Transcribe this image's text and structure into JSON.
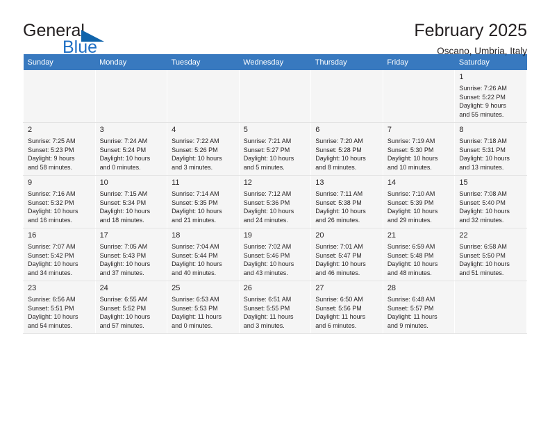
{
  "logo": {
    "word_one": "General",
    "word_two": "Blue",
    "triangle_icon": "blue-triangle-icon",
    "brand_blue": "#1f6fc4",
    "triangle_blue": "#1064ab"
  },
  "header": {
    "title": "February 2025",
    "subtitle": "Oscano, Umbria, Italy"
  },
  "calendar": {
    "header_background": "#3879bf",
    "header_text_color": "#ffffff",
    "shaded_row_background": "#f5f5f5",
    "weekdays": [
      "Sunday",
      "Monday",
      "Tuesday",
      "Wednesday",
      "Thursday",
      "Friday",
      "Saturday"
    ],
    "weeks": [
      [
        {
          "day": "",
          "detail": ""
        },
        {
          "day": "",
          "detail": ""
        },
        {
          "day": "",
          "detail": ""
        },
        {
          "day": "",
          "detail": ""
        },
        {
          "day": "",
          "detail": ""
        },
        {
          "day": "",
          "detail": ""
        },
        {
          "day": "1",
          "detail": "Sunrise: 7:26 AM\nSunset: 5:22 PM\nDaylight: 9 hours\nand 55 minutes."
        }
      ],
      [
        {
          "day": "2",
          "detail": "Sunrise: 7:25 AM\nSunset: 5:23 PM\nDaylight: 9 hours\nand 58 minutes."
        },
        {
          "day": "3",
          "detail": "Sunrise: 7:24 AM\nSunset: 5:24 PM\nDaylight: 10 hours\nand 0 minutes."
        },
        {
          "day": "4",
          "detail": "Sunrise: 7:22 AM\nSunset: 5:26 PM\nDaylight: 10 hours\nand 3 minutes."
        },
        {
          "day": "5",
          "detail": "Sunrise: 7:21 AM\nSunset: 5:27 PM\nDaylight: 10 hours\nand 5 minutes."
        },
        {
          "day": "6",
          "detail": "Sunrise: 7:20 AM\nSunset: 5:28 PM\nDaylight: 10 hours\nand 8 minutes."
        },
        {
          "day": "7",
          "detail": "Sunrise: 7:19 AM\nSunset: 5:30 PM\nDaylight: 10 hours\nand 10 minutes."
        },
        {
          "day": "8",
          "detail": "Sunrise: 7:18 AM\nSunset: 5:31 PM\nDaylight: 10 hours\nand 13 minutes."
        }
      ],
      [
        {
          "day": "9",
          "detail": "Sunrise: 7:16 AM\nSunset: 5:32 PM\nDaylight: 10 hours\nand 16 minutes."
        },
        {
          "day": "10",
          "detail": "Sunrise: 7:15 AM\nSunset: 5:34 PM\nDaylight: 10 hours\nand 18 minutes."
        },
        {
          "day": "11",
          "detail": "Sunrise: 7:14 AM\nSunset: 5:35 PM\nDaylight: 10 hours\nand 21 minutes."
        },
        {
          "day": "12",
          "detail": "Sunrise: 7:12 AM\nSunset: 5:36 PM\nDaylight: 10 hours\nand 24 minutes."
        },
        {
          "day": "13",
          "detail": "Sunrise: 7:11 AM\nSunset: 5:38 PM\nDaylight: 10 hours\nand 26 minutes."
        },
        {
          "day": "14",
          "detail": "Sunrise: 7:10 AM\nSunset: 5:39 PM\nDaylight: 10 hours\nand 29 minutes."
        },
        {
          "day": "15",
          "detail": "Sunrise: 7:08 AM\nSunset: 5:40 PM\nDaylight: 10 hours\nand 32 minutes."
        }
      ],
      [
        {
          "day": "16",
          "detail": "Sunrise: 7:07 AM\nSunset: 5:42 PM\nDaylight: 10 hours\nand 34 minutes."
        },
        {
          "day": "17",
          "detail": "Sunrise: 7:05 AM\nSunset: 5:43 PM\nDaylight: 10 hours\nand 37 minutes."
        },
        {
          "day": "18",
          "detail": "Sunrise: 7:04 AM\nSunset: 5:44 PM\nDaylight: 10 hours\nand 40 minutes."
        },
        {
          "day": "19",
          "detail": "Sunrise: 7:02 AM\nSunset: 5:46 PM\nDaylight: 10 hours\nand 43 minutes."
        },
        {
          "day": "20",
          "detail": "Sunrise: 7:01 AM\nSunset: 5:47 PM\nDaylight: 10 hours\nand 46 minutes."
        },
        {
          "day": "21",
          "detail": "Sunrise: 6:59 AM\nSunset: 5:48 PM\nDaylight: 10 hours\nand 48 minutes."
        },
        {
          "day": "22",
          "detail": "Sunrise: 6:58 AM\nSunset: 5:50 PM\nDaylight: 10 hours\nand 51 minutes."
        }
      ],
      [
        {
          "day": "23",
          "detail": "Sunrise: 6:56 AM\nSunset: 5:51 PM\nDaylight: 10 hours\nand 54 minutes."
        },
        {
          "day": "24",
          "detail": "Sunrise: 6:55 AM\nSunset: 5:52 PM\nDaylight: 10 hours\nand 57 minutes."
        },
        {
          "day": "25",
          "detail": "Sunrise: 6:53 AM\nSunset: 5:53 PM\nDaylight: 11 hours\nand 0 minutes."
        },
        {
          "day": "26",
          "detail": "Sunrise: 6:51 AM\nSunset: 5:55 PM\nDaylight: 11 hours\nand 3 minutes."
        },
        {
          "day": "27",
          "detail": "Sunrise: 6:50 AM\nSunset: 5:56 PM\nDaylight: 11 hours\nand 6 minutes."
        },
        {
          "day": "28",
          "detail": "Sunrise: 6:48 AM\nSunset: 5:57 PM\nDaylight: 11 hours\nand 9 minutes."
        },
        {
          "day": "",
          "detail": ""
        }
      ]
    ]
  }
}
